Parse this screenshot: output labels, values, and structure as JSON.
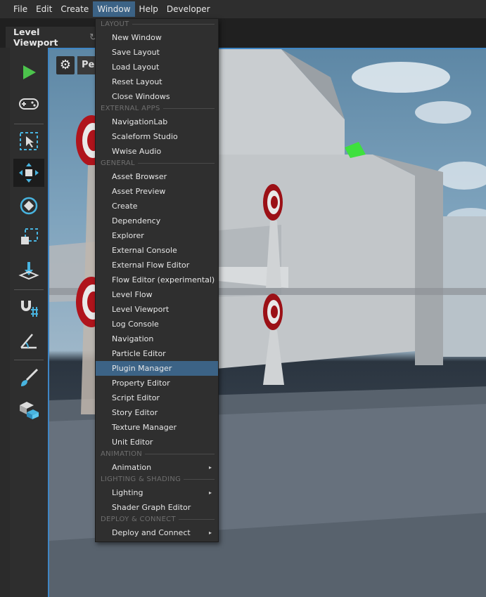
{
  "menubar": {
    "items": [
      {
        "label": "File"
      },
      {
        "label": "Edit"
      },
      {
        "label": "Create"
      },
      {
        "label": "Window",
        "active": true
      },
      {
        "label": "Help"
      },
      {
        "label": "Developer"
      }
    ]
  },
  "tab": {
    "title": "Level Viewport",
    "refresh_icon": "refresh-icon"
  },
  "viewport": {
    "camera_label": "Per"
  },
  "toolbar": {
    "tools": [
      "play-icon",
      "gamepad-icon",
      "select-icon",
      "move-icon",
      "rotate-icon",
      "scale-icon",
      "place-icon",
      "snap-magnet-icon",
      "angle-icon",
      "paint-brush-icon",
      "unit-stack-icon"
    ],
    "accent_color": "#48b4e0",
    "play_color": "#4cc44c"
  },
  "window_menu": {
    "highlight_color": "#3c6386",
    "sections": [
      {
        "title": "LAYOUT",
        "items": [
          {
            "label": "New Window"
          },
          {
            "label": "Save Layout"
          },
          {
            "label": "Load Layout"
          },
          {
            "label": "Reset Layout"
          },
          {
            "label": "Close Windows"
          }
        ]
      },
      {
        "title": "EXTERNAL APPS",
        "items": [
          {
            "label": "NavigationLab"
          },
          {
            "label": "Scaleform Studio"
          },
          {
            "label": "Wwise Audio"
          }
        ]
      },
      {
        "title": "GENERAL",
        "items": [
          {
            "label": "Asset Browser"
          },
          {
            "label": "Asset Preview"
          },
          {
            "label": "Create"
          },
          {
            "label": "Dependency"
          },
          {
            "label": "Explorer"
          },
          {
            "label": "External Console"
          },
          {
            "label": "External Flow Editor"
          },
          {
            "label": "Flow Editor (experimental)"
          },
          {
            "label": "Level Flow"
          },
          {
            "label": "Level Viewport"
          },
          {
            "label": "Log Console"
          },
          {
            "label": "Navigation"
          },
          {
            "label": "Particle Editor"
          },
          {
            "label": "Plugin Manager",
            "highlighted": true
          },
          {
            "label": "Property Editor"
          },
          {
            "label": "Script Editor"
          },
          {
            "label": "Story Editor"
          },
          {
            "label": "Texture Manager"
          },
          {
            "label": "Unit Editor"
          }
        ]
      },
      {
        "title": "ANIMATION",
        "items": [
          {
            "label": "Animation",
            "submenu": true
          }
        ]
      },
      {
        "title": "LIGHTING & SHADING",
        "items": [
          {
            "label": "Lighting",
            "submenu": true
          },
          {
            "label": "Shader Graph Editor"
          }
        ]
      },
      {
        "title": "DEPLOY & CONNECT",
        "items": [
          {
            "label": "Deploy and Connect",
            "submenu": true
          }
        ]
      }
    ]
  }
}
